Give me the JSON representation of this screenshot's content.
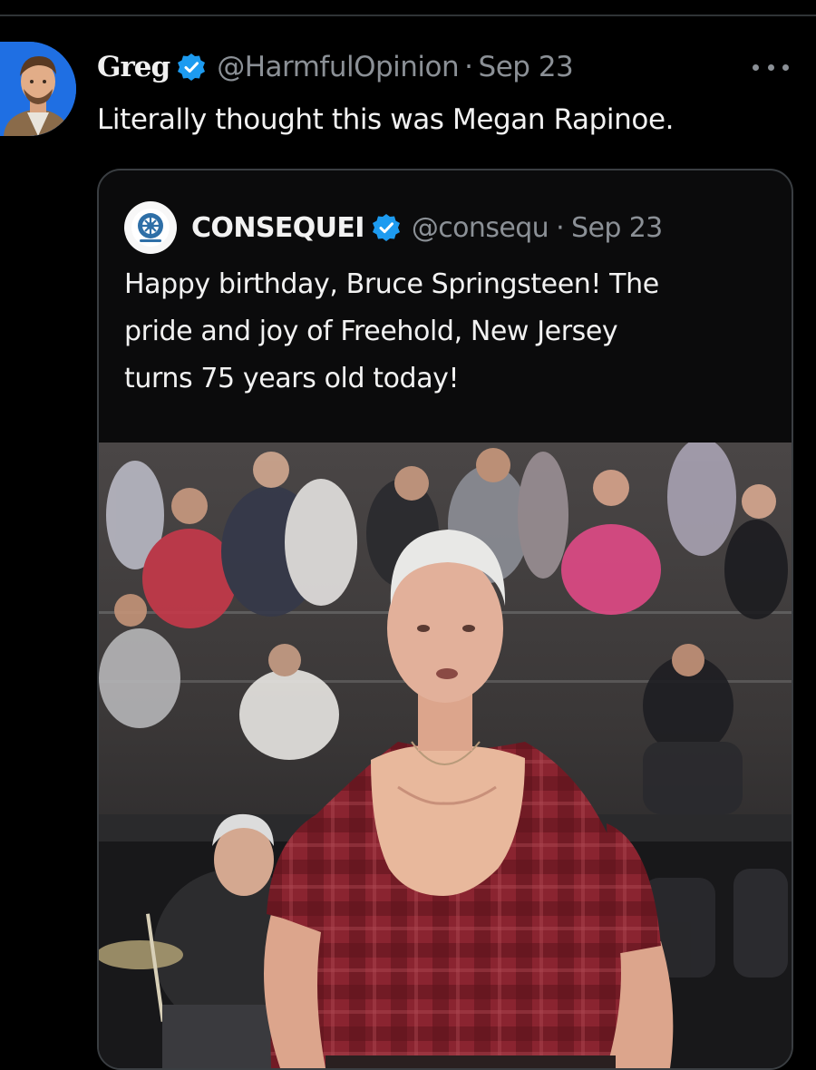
{
  "tweet": {
    "author": {
      "display_name": "Greg",
      "handle": "@HarmfulOpinion",
      "separator": "·",
      "date": "Sep 23",
      "verified": true,
      "avatar_icon": "avatar-photo"
    },
    "text": "Literally thought this was Megan Rapinoe.",
    "more_icon": "more-dots-icon"
  },
  "quoted_tweet": {
    "author": {
      "display_name": "CONSEQUEI",
      "handle": "@consequ",
      "separator": "·",
      "date": "Sep 23",
      "verified": true,
      "logo_icon": "consequence-logo"
    },
    "lines": [
      "Happy birthday, Bruce Springsteen! The",
      "pride and joy of Freehold, New Jersey",
      "turns 75 years old today!"
    ],
    "media": {
      "kind": "photo",
      "subject_icon": "concert-photo"
    }
  },
  "colors": {
    "background": "#000000",
    "text_primary": "#f2f2f2",
    "text_secondary": "#8b9096",
    "verified_blue": "#1d9bf0",
    "card_border": "#3a3e42",
    "shirt_red": "#8e2430"
  }
}
